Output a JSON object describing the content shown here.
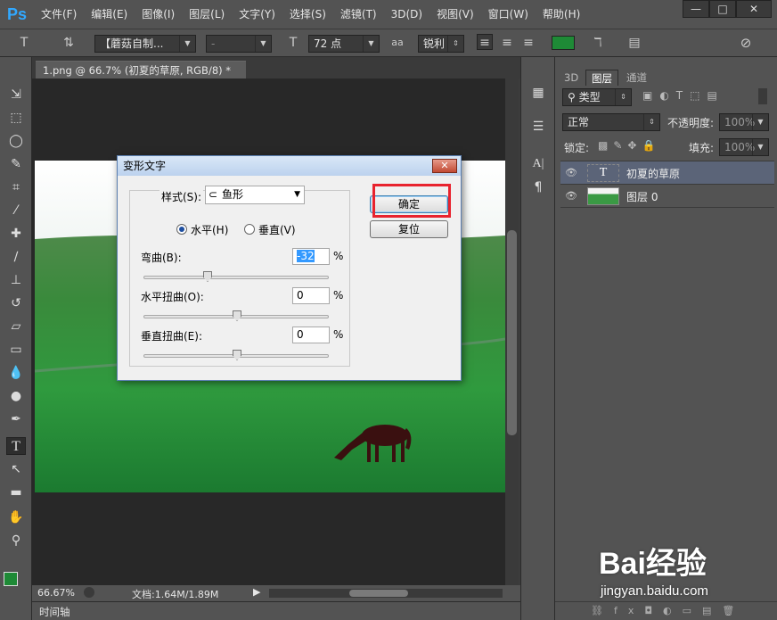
{
  "app": {
    "logo": "Ps"
  },
  "menu": [
    "文件(F)",
    "编辑(E)",
    "图像(I)",
    "图层(L)",
    "文字(Y)",
    "选择(S)",
    "滤镜(T)",
    "3D(D)",
    "视图(V)",
    "窗口(W)",
    "帮助(H)"
  ],
  "window_buttons": {
    "minimize": "—",
    "restore": "□",
    "close": "✕"
  },
  "options": {
    "font_family": "【蘑菇自制...",
    "font_style": "-",
    "font_size": "72 点",
    "antialias_icon": "aa",
    "antialias": "锐利",
    "text_color": "#1e8a36"
  },
  "document": {
    "tab": "1.png @ 66.7% (初夏的草原, RGB/8) *",
    "zoom": "66.67%",
    "doc_info": "文档:1.64M/1.89M"
  },
  "timeline_label": "时间轴",
  "layers_panel": {
    "tabs": [
      "3D",
      "图层",
      "通道"
    ],
    "filter_label": "类型",
    "blend_mode": "正常",
    "opacity_label": "不透明度:",
    "opacity_value": "100%",
    "lock_label": "锁定:",
    "fill_label": "填充:",
    "fill_value": "100%",
    "layers": [
      {
        "name": "初夏的草原",
        "thumb_icon": "T"
      },
      {
        "name": "图层 0"
      }
    ]
  },
  "dialog": {
    "title": "变形文字",
    "style_label": "样式(S):",
    "style_value": "鱼形",
    "orient_h": "水平(H)",
    "orient_v": "垂直(V)",
    "bend_label": "弯曲(B):",
    "bend_value": "-32",
    "hdist_label": "水平扭曲(O):",
    "hdist_value": "0",
    "vdist_label": "垂直扭曲(E):",
    "vdist_value": "0",
    "percent": "%",
    "ok_label": "确定",
    "reset_label": "复位"
  },
  "watermark": {
    "brand": "Bai经验",
    "url": "jingyan.baidu.com"
  }
}
